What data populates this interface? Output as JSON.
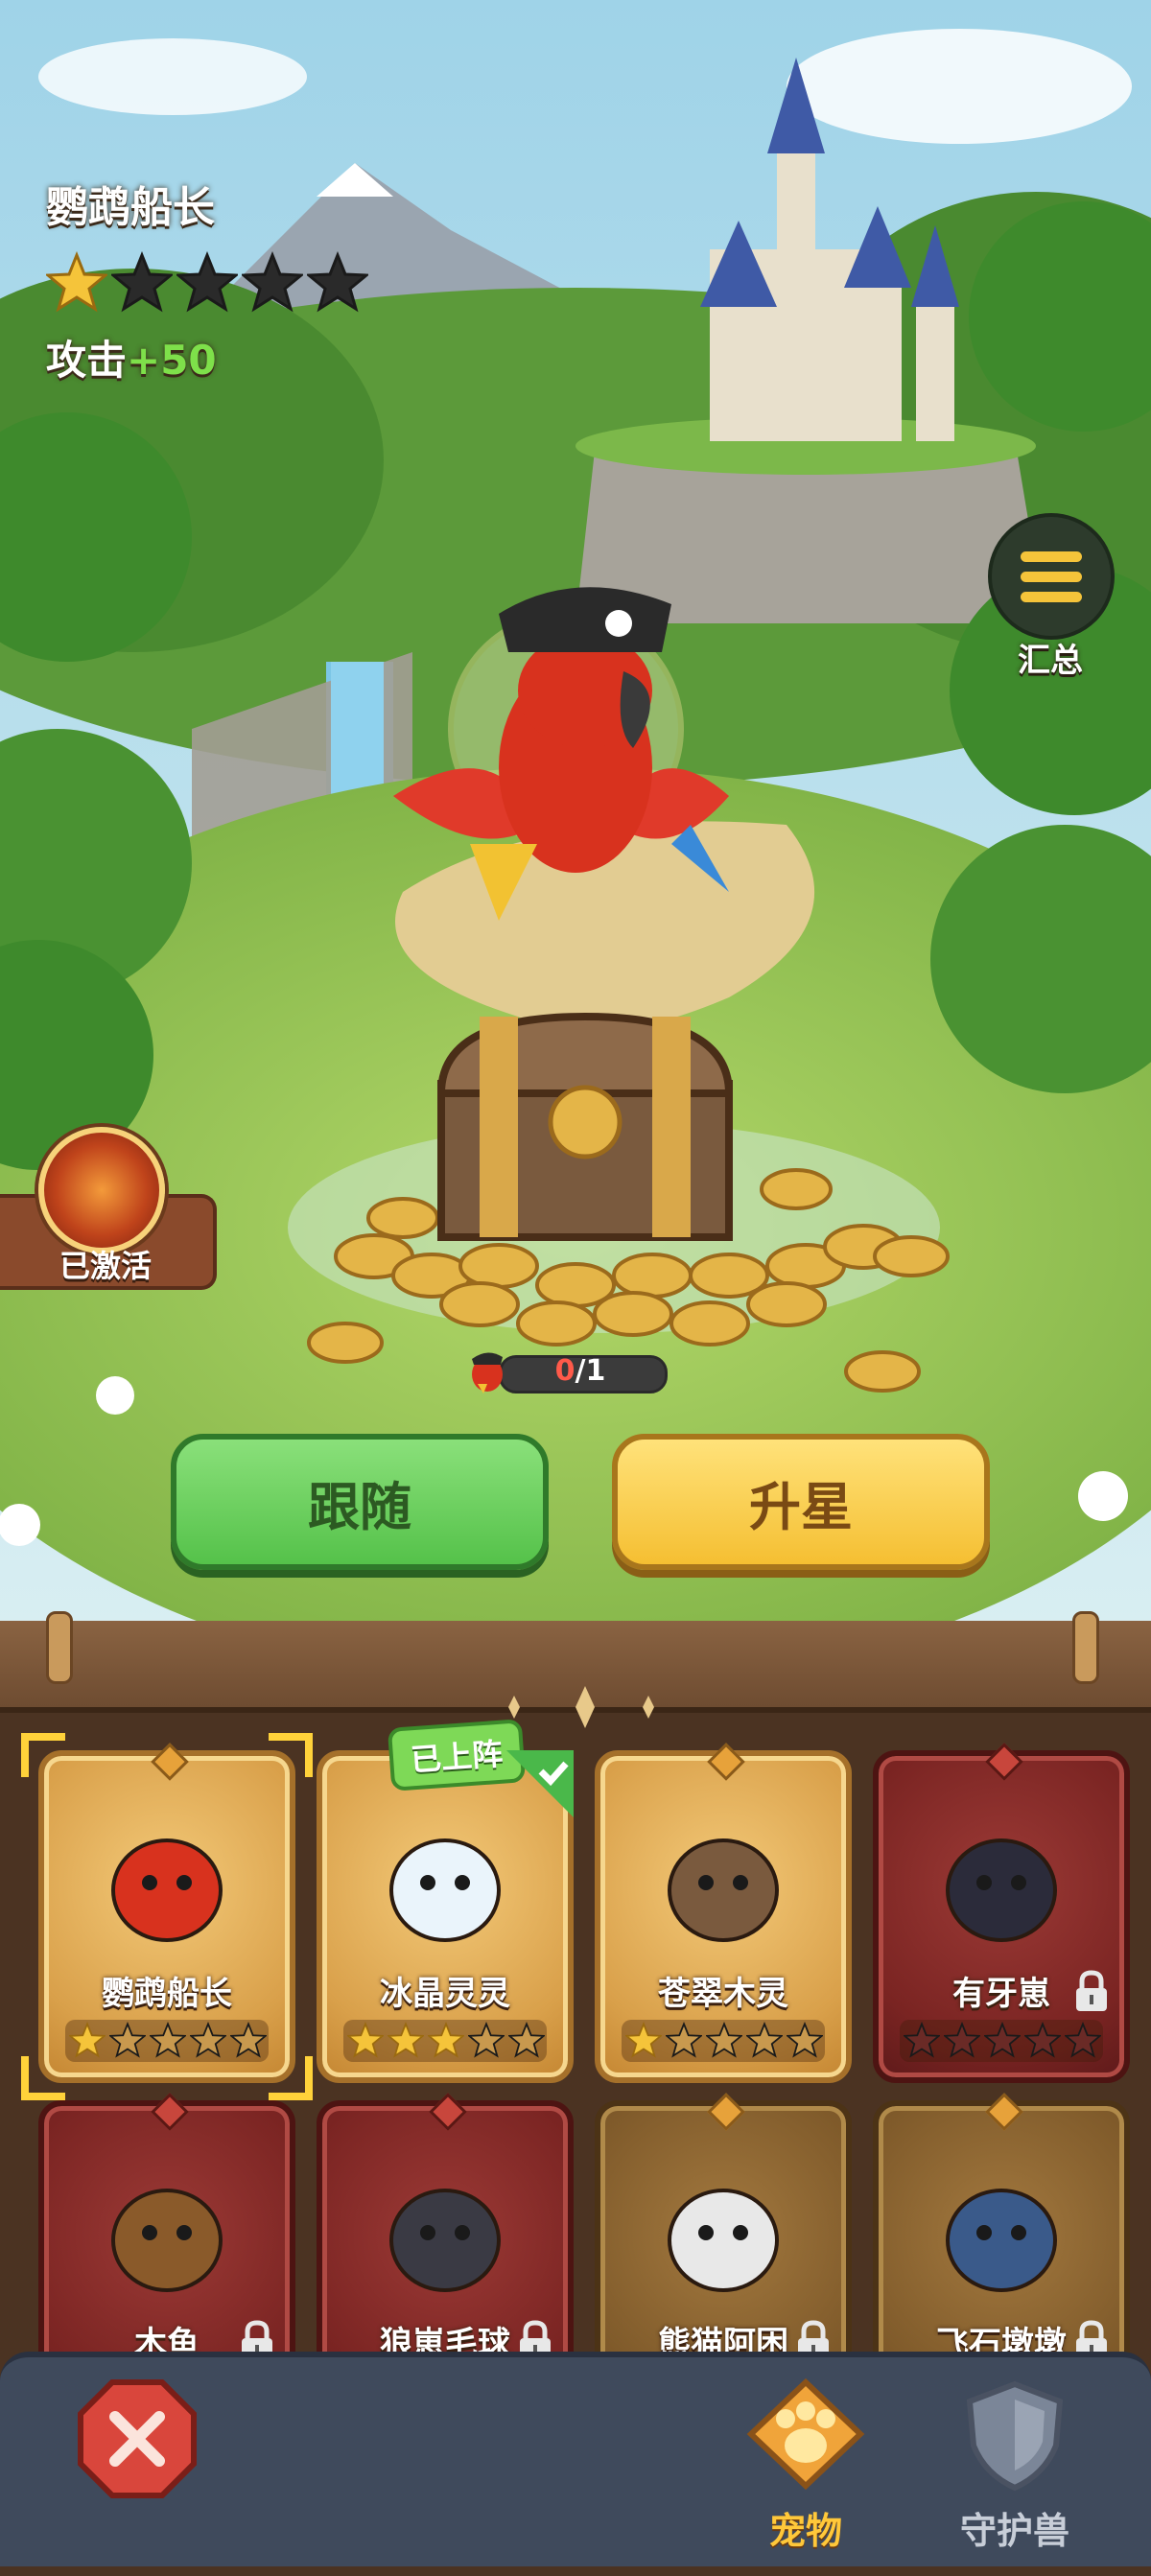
{
  "pet": {
    "name": "鹦鹉船长",
    "stars_filled": 1,
    "stars_total": 5,
    "attack_label": "攻击",
    "attack_bonus": "+50"
  },
  "summary": {
    "label": "汇总",
    "icon": "menu-list-icon"
  },
  "skill": {
    "label": "已激活",
    "icon": "fire-skill-icon"
  },
  "progress": {
    "current": "0",
    "total": "/1"
  },
  "buttons": {
    "follow": "跟随",
    "upgrade": "升星"
  },
  "deployed_tag": "已上阵",
  "pets": [
    {
      "name": "鹦鹉船长",
      "stars": 1,
      "unlocked": true,
      "selected": true,
      "deployed": false
    },
    {
      "name": "冰晶灵灵",
      "stars": 3,
      "unlocked": true,
      "selected": false,
      "deployed": true
    },
    {
      "name": "苍翠木灵",
      "stars": 1,
      "unlocked": true,
      "selected": false,
      "deployed": false
    },
    {
      "name": "有牙崽",
      "stars": 0,
      "unlocked": false,
      "selected": false,
      "deployed": false
    },
    {
      "name": "木鱼",
      "stars": 0,
      "unlocked": false,
      "selected": false,
      "deployed": false
    },
    {
      "name": "狼崽毛球",
      "stars": 0,
      "unlocked": false,
      "selected": false,
      "deployed": false
    },
    {
      "name": "熊猫阿困",
      "stars": 0,
      "unlocked": false,
      "selected": false,
      "deployed": false
    },
    {
      "name": "飞石墩墩",
      "stars": 0,
      "unlocked": false,
      "selected": false,
      "deployed": false
    }
  ],
  "nav": {
    "pets": "宠物",
    "guardian": "守护兽"
  },
  "colors": {
    "star_gold": "#f5c43a",
    "star_empty": "#2a2a2a",
    "follow_green": "#55c24a",
    "upgrade_yellow": "#f5bf32",
    "nav_active": "#ffc83a"
  }
}
